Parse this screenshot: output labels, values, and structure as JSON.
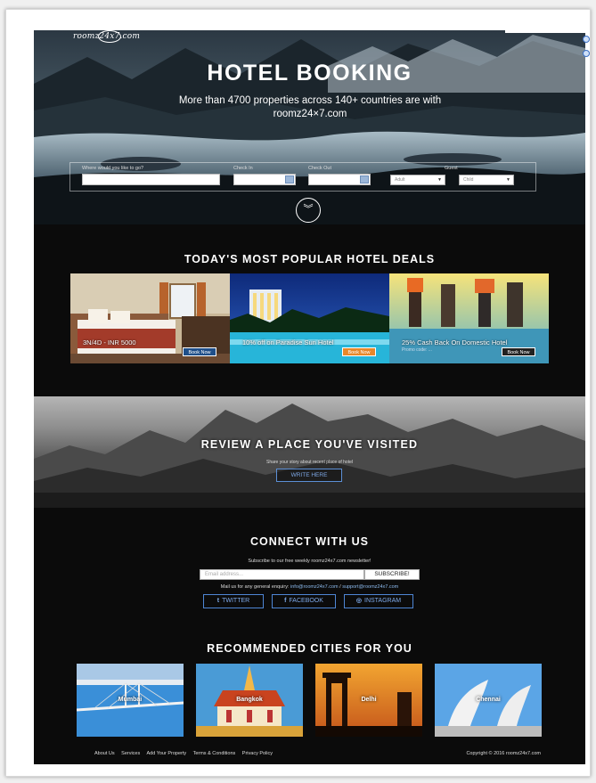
{
  "brand": {
    "logo_text": "roomz24x7.com"
  },
  "hero": {
    "title": "HOTEL BOOKING",
    "subtitle": "More than 4700 properties across 140+ countries are with roomz24×7.com",
    "search": {
      "destination_label": "Where would you like to go?",
      "checkin_label": "Check In",
      "checkout_label": "Check Out",
      "guest_label": "Guest",
      "adult_option": "Adult",
      "child_option": "Child"
    },
    "scroll_icon": "chevron-double-down"
  },
  "deals": {
    "title": "TODAY'S MOST POPULAR HOTEL DEALS",
    "items": [
      {
        "caption": "3N/4D - INR 5000",
        "sub": "",
        "button": "Book Now"
      },
      {
        "caption": "10% off on Paradise Sun Hotel",
        "sub": "",
        "button": "Book Now"
      },
      {
        "caption": "25% Cash Back On Domestic Hotel",
        "sub": "Promo code: ...",
        "button": "Book Now"
      }
    ]
  },
  "review": {
    "title": "REVIEW A PLACE YOU'VE VISITED",
    "subtitle": "Share your story about recent place of hotel",
    "button": "WRITE HERE"
  },
  "connect": {
    "title": "CONNECT WITH US",
    "subtitle": "Subscribe to our free weekly roomz24x7.com newsletter!",
    "email_placeholder": "Email address...",
    "subscribe_label": "SUBSCRIBE!",
    "mail_prefix": "Mail us for any general enquiry:",
    "mail_info": "info@roomz24x7.com",
    "mail_sep": "/",
    "mail_support": "support@roomz24x7.com",
    "social": [
      {
        "icon": "twitter-icon",
        "glyph": "t",
        "label": "TWITTER"
      },
      {
        "icon": "facebook-icon",
        "glyph": "f",
        "label": "FACEBOOK"
      },
      {
        "icon": "instagram-icon",
        "glyph": "◎",
        "label": "INSTAGRAM"
      }
    ]
  },
  "cities": {
    "title": "RECOMMENDED CITIES FOR YOU",
    "items": [
      {
        "name": "Mumbai"
      },
      {
        "name": "Bangkok"
      },
      {
        "name": "Delhi"
      },
      {
        "name": "Chennai"
      }
    ]
  },
  "footer": {
    "links": [
      "About Us",
      "Services",
      "Add Your Property",
      "Terms & Conditions",
      "Privacy Policy"
    ],
    "copyright": "Copyright © 2016 roomz24x7.com"
  },
  "colors": {
    "accent_orange": "#e8872a",
    "accent_blue": "#4e86d4",
    "background": "#0b0b0b"
  }
}
